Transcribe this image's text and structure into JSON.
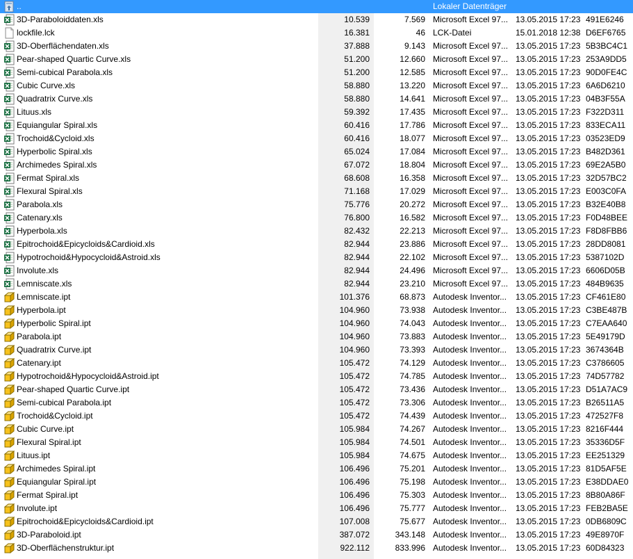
{
  "colors": {
    "selection": "#3399ff",
    "size_column_bg": "#f0f0f0",
    "excel_green": "#1e7145",
    "inventor_yellow": "#f7c21c"
  },
  "parent_row": {
    "icon": "folder-up-icon",
    "name": "..",
    "type": "Lokaler Datenträger"
  },
  "files": [
    {
      "icon": "excel-file-icon",
      "name": "3D-Paraboloiddaten.xls",
      "size": "10.539",
      "packed": "7.569",
      "type": "Microsoft Excel 97...",
      "modified": "13.05.2015 17:23",
      "crc": "491E6246"
    },
    {
      "icon": "text-file-icon",
      "name": "lockfile.lck",
      "size": "16.381",
      "packed": "46",
      "type": "LCK-Datei",
      "modified": "15.01.2018 12:38",
      "crc": "D6EF6765"
    },
    {
      "icon": "excel-file-icon",
      "name": "3D-Oberflächendaten.xls",
      "size": "37.888",
      "packed": "9.143",
      "type": "Microsoft Excel 97...",
      "modified": "13.05.2015 17:23",
      "crc": "5B3BC4C1"
    },
    {
      "icon": "excel-file-icon",
      "name": "Pear-shaped Quartic Curve.xls",
      "size": "51.200",
      "packed": "12.660",
      "type": "Microsoft Excel 97...",
      "modified": "13.05.2015 17:23",
      "crc": "253A9DD5"
    },
    {
      "icon": "excel-file-icon",
      "name": "Semi-cubical Parabola.xls",
      "size": "51.200",
      "packed": "12.585",
      "type": "Microsoft Excel 97...",
      "modified": "13.05.2015 17:23",
      "crc": "90D0FE4C"
    },
    {
      "icon": "excel-file-icon",
      "name": "Cubic Curve.xls",
      "size": "58.880",
      "packed": "13.220",
      "type": "Microsoft Excel 97...",
      "modified": "13.05.2015 17:23",
      "crc": "6A6D6210"
    },
    {
      "icon": "excel-file-icon",
      "name": "Quadratrix Curve.xls",
      "size": "58.880",
      "packed": "14.641",
      "type": "Microsoft Excel 97...",
      "modified": "13.05.2015 17:23",
      "crc": "04B3F55A"
    },
    {
      "icon": "excel-file-icon",
      "name": "Lituus.xls",
      "size": "59.392",
      "packed": "17.435",
      "type": "Microsoft Excel 97...",
      "modified": "13.05.2015 17:23",
      "crc": "F322D311"
    },
    {
      "icon": "excel-file-icon",
      "name": "Equiangular Spiral.xls",
      "size": "60.416",
      "packed": "17.786",
      "type": "Microsoft Excel 97...",
      "modified": "13.05.2015 17:23",
      "crc": "833ECA11"
    },
    {
      "icon": "excel-file-icon",
      "name": "Trochoid&Cycloid.xls",
      "size": "60.416",
      "packed": "18.077",
      "type": "Microsoft Excel 97...",
      "modified": "13.05.2015 17:23",
      "crc": "03523ED9"
    },
    {
      "icon": "excel-file-icon",
      "name": "Hyperbolic Spiral.xls",
      "size": "65.024",
      "packed": "17.084",
      "type": "Microsoft Excel 97...",
      "modified": "13.05.2015 17:23",
      "crc": "B482D361"
    },
    {
      "icon": "excel-file-icon",
      "name": "Archimedes Spiral.xls",
      "size": "67.072",
      "packed": "18.804",
      "type": "Microsoft Excel 97...",
      "modified": "13.05.2015 17:23",
      "crc": "69E2A5B0"
    },
    {
      "icon": "excel-file-icon",
      "name": "Fermat Spiral.xls",
      "size": "68.608",
      "packed": "16.358",
      "type": "Microsoft Excel 97...",
      "modified": "13.05.2015 17:23",
      "crc": "32D57BC2"
    },
    {
      "icon": "excel-file-icon",
      "name": "Flexural Spiral.xls",
      "size": "71.168",
      "packed": "17.029",
      "type": "Microsoft Excel 97...",
      "modified": "13.05.2015 17:23",
      "crc": "E003C0FA"
    },
    {
      "icon": "excel-file-icon",
      "name": "Parabola.xls",
      "size": "75.776",
      "packed": "20.272",
      "type": "Microsoft Excel 97...",
      "modified": "13.05.2015 17:23",
      "crc": "B32E40B8"
    },
    {
      "icon": "excel-file-icon",
      "name": "Catenary.xls",
      "size": "76.800",
      "packed": "16.582",
      "type": "Microsoft Excel 97...",
      "modified": "13.05.2015 17:23",
      "crc": "F0D48BEE"
    },
    {
      "icon": "excel-file-icon",
      "name": "Hyperbola.xls",
      "size": "82.432",
      "packed": "22.213",
      "type": "Microsoft Excel 97...",
      "modified": "13.05.2015 17:23",
      "crc": "F8D8FBB6"
    },
    {
      "icon": "excel-file-icon",
      "name": "Epitrochoid&Epicycloids&Cardioid.xls",
      "size": "82.944",
      "packed": "23.886",
      "type": "Microsoft Excel 97...",
      "modified": "13.05.2015 17:23",
      "crc": "28DD8081"
    },
    {
      "icon": "excel-file-icon",
      "name": "Hypotrochoid&Hypocycloid&Astroid.xls",
      "size": "82.944",
      "packed": "22.102",
      "type": "Microsoft Excel 97...",
      "modified": "13.05.2015 17:23",
      "crc": "5387102D"
    },
    {
      "icon": "excel-file-icon",
      "name": "Involute.xls",
      "size": "82.944",
      "packed": "24.496",
      "type": "Microsoft Excel 97...",
      "modified": "13.05.2015 17:23",
      "crc": "6606D05B"
    },
    {
      "icon": "excel-file-icon",
      "name": "Lemniscate.xls",
      "size": "82.944",
      "packed": "23.210",
      "type": "Microsoft Excel 97...",
      "modified": "13.05.2015 17:23",
      "crc": "484B9635"
    },
    {
      "icon": "inventor-part-icon",
      "name": "Lemniscate.ipt",
      "size": "101.376",
      "packed": "68.873",
      "type": "Autodesk Inventor...",
      "modified": "13.05.2015 17:23",
      "crc": "CF461E80"
    },
    {
      "icon": "inventor-part-icon",
      "name": "Hyperbola.ipt",
      "size": "104.960",
      "packed": "73.938",
      "type": "Autodesk Inventor...",
      "modified": "13.05.2015 17:23",
      "crc": "C3BE487B"
    },
    {
      "icon": "inventor-part-icon",
      "name": "Hyperbolic Spiral.ipt",
      "size": "104.960",
      "packed": "74.043",
      "type": "Autodesk Inventor...",
      "modified": "13.05.2015 17:23",
      "crc": "C7EAA640"
    },
    {
      "icon": "inventor-part-icon",
      "name": "Parabola.ipt",
      "size": "104.960",
      "packed": "73.883",
      "type": "Autodesk Inventor...",
      "modified": "13.05.2015 17:23",
      "crc": "5E49179D"
    },
    {
      "icon": "inventor-part-icon",
      "name": "Quadratrix Curve.ipt",
      "size": "104.960",
      "packed": "73.393",
      "type": "Autodesk Inventor...",
      "modified": "13.05.2015 17:23",
      "crc": "3674364B"
    },
    {
      "icon": "inventor-part-icon",
      "name": "Catenary.ipt",
      "size": "105.472",
      "packed": "74.129",
      "type": "Autodesk Inventor...",
      "modified": "13.05.2015 17:23",
      "crc": "C3786605"
    },
    {
      "icon": "inventor-part-icon",
      "name": "Hypotrochoid&Hypocycloid&Astroid.ipt",
      "size": "105.472",
      "packed": "74.785",
      "type": "Autodesk Inventor...",
      "modified": "13.05.2015 17:23",
      "crc": "74D57782"
    },
    {
      "icon": "inventor-part-icon",
      "name": "Pear-shaped Quartic Curve.ipt",
      "size": "105.472",
      "packed": "73.436",
      "type": "Autodesk Inventor...",
      "modified": "13.05.2015 17:23",
      "crc": "D51A7AC9"
    },
    {
      "icon": "inventor-part-icon",
      "name": "Semi-cubical Parabola.ipt",
      "size": "105.472",
      "packed": "73.306",
      "type": "Autodesk Inventor...",
      "modified": "13.05.2015 17:23",
      "crc": "B26511A5"
    },
    {
      "icon": "inventor-part-icon",
      "name": "Trochoid&Cycloid.ipt",
      "size": "105.472",
      "packed": "74.439",
      "type": "Autodesk Inventor...",
      "modified": "13.05.2015 17:23",
      "crc": "472527F8"
    },
    {
      "icon": "inventor-part-icon",
      "name": "Cubic Curve.ipt",
      "size": "105.984",
      "packed": "74.267",
      "type": "Autodesk Inventor...",
      "modified": "13.05.2015 17:23",
      "crc": "8216F444"
    },
    {
      "icon": "inventor-part-icon",
      "name": "Flexural Spiral.ipt",
      "size": "105.984",
      "packed": "74.501",
      "type": "Autodesk Inventor...",
      "modified": "13.05.2015 17:23",
      "crc": "35336D5F"
    },
    {
      "icon": "inventor-part-icon",
      "name": "Lituus.ipt",
      "size": "105.984",
      "packed": "74.675",
      "type": "Autodesk Inventor...",
      "modified": "13.05.2015 17:23",
      "crc": "EE251329"
    },
    {
      "icon": "inventor-part-icon",
      "name": "Archimedes Spiral.ipt",
      "size": "106.496",
      "packed": "75.201",
      "type": "Autodesk Inventor...",
      "modified": "13.05.2015 17:23",
      "crc": "81D5AF5E"
    },
    {
      "icon": "inventor-part-icon",
      "name": "Equiangular Spiral.ipt",
      "size": "106.496",
      "packed": "75.198",
      "type": "Autodesk Inventor...",
      "modified": "13.05.2015 17:23",
      "crc": "E38DDAE0"
    },
    {
      "icon": "inventor-part-icon",
      "name": "Fermat Spiral.ipt",
      "size": "106.496",
      "packed": "75.303",
      "type": "Autodesk Inventor...",
      "modified": "13.05.2015 17:23",
      "crc": "8B80A86F"
    },
    {
      "icon": "inventor-part-icon",
      "name": "Involute.ipt",
      "size": "106.496",
      "packed": "75.777",
      "type": "Autodesk Inventor...",
      "modified": "13.05.2015 17:23",
      "crc": "FEB2BA5E"
    },
    {
      "icon": "inventor-part-icon",
      "name": "Epitrochoid&Epicycloids&Cardioid.ipt",
      "size": "107.008",
      "packed": "75.677",
      "type": "Autodesk Inventor...",
      "modified": "13.05.2015 17:23",
      "crc": "0DB6809C"
    },
    {
      "icon": "inventor-part-icon",
      "name": "3D-Paraboloid.ipt",
      "size": "387.072",
      "packed": "343.148",
      "type": "Autodesk Inventor...",
      "modified": "13.05.2015 17:23",
      "crc": "49E8970F"
    },
    {
      "icon": "inventor-part-icon",
      "name": "3D-Oberflächenstruktur.ipt",
      "size": "922.112",
      "packed": "833.996",
      "type": "Autodesk Inventor...",
      "modified": "13.05.2015 17:23",
      "crc": "60D84323"
    }
  ]
}
